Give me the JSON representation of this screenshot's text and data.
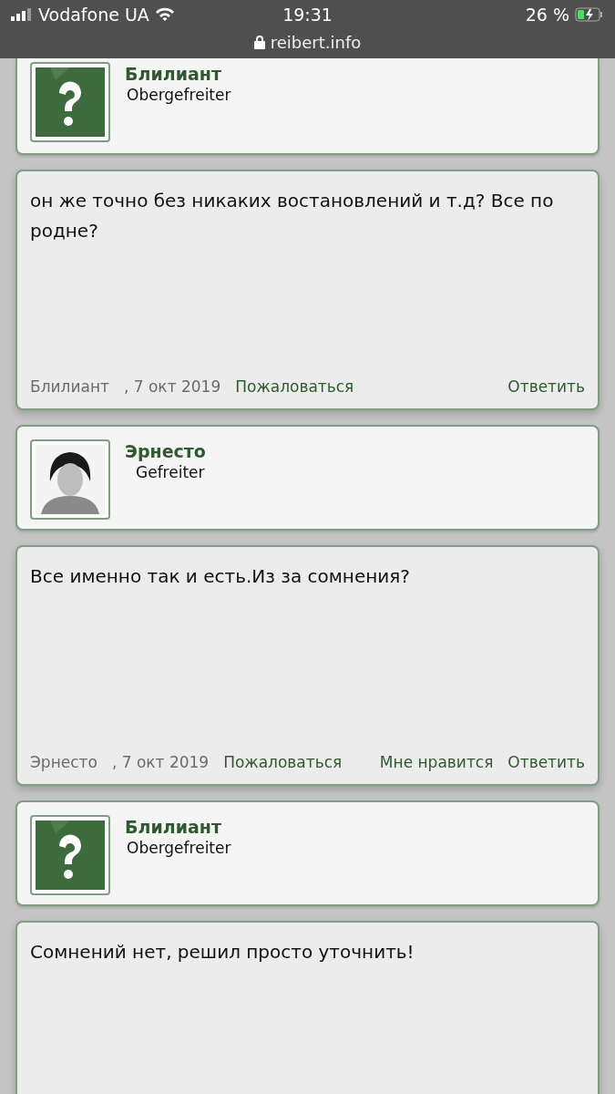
{
  "status_bar": {
    "carrier": "Vodafone UA",
    "time": "19:31",
    "battery": "26 %",
    "url": "reibert.info"
  },
  "thread": [
    {
      "kind": "user",
      "name": "Блилиант",
      "rank": "Obergefreiter",
      "avatar": {
        "kind": "default"
      }
    },
    {
      "kind": "post",
      "text": "он же точно без никаких востановлений и т.д? Все по родне?",
      "author": "Блилиант",
      "date": ", 7 окт 2019",
      "actions": [
        {
          "kind": "report",
          "label": "Пожаловаться"
        },
        {
          "kind": "reply",
          "label": "Ответить"
        }
      ]
    },
    {
      "kind": "user",
      "name": "Эрнесто",
      "rank": "Gefreiter"
    },
    {
      "kind": "post",
      "text": "Все именно так и есть.Из за сомнения?",
      "author": "Эрнесто",
      "date": ", 7 окт 2019",
      "actions": [
        {
          "kind": "report",
          "label": "Пожаловаться"
        },
        {
          "kind": "like",
          "label": "Мне нравится"
        },
        {
          "kind": "reply",
          "label": "Ответить"
        }
      ]
    },
    {
      "kind": "user",
      "name": "Блилиант",
      "rank": "Obergefreiter",
      "avatar": {
        "kind": "default"
      }
    },
    {
      "kind": "post",
      "text": "Сомнений нет, решил просто уточнить!"
    }
  ]
}
